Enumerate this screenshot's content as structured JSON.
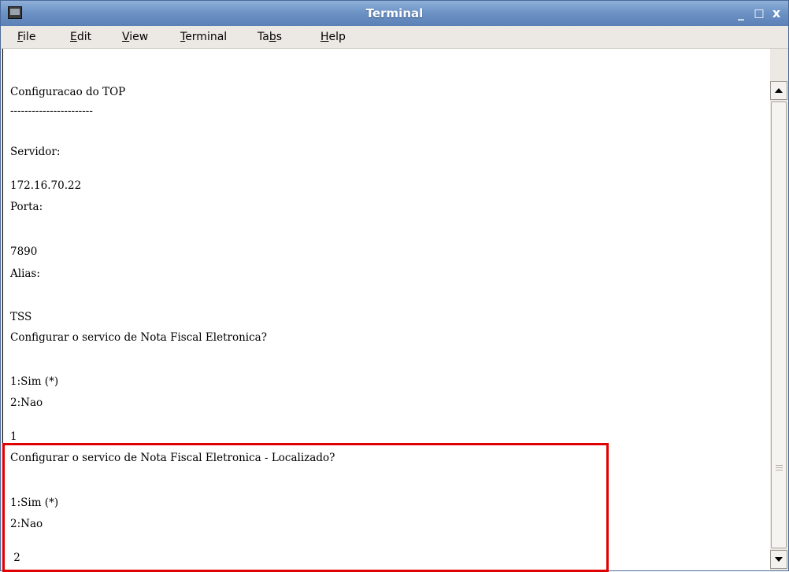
{
  "window": {
    "title": "Terminal"
  },
  "controls": {
    "minimize": "_",
    "maximize": "□",
    "close": "x"
  },
  "menu": {
    "file": {
      "u": "F",
      "rest": "ile"
    },
    "edit": {
      "u": "E",
      "rest": "dit"
    },
    "view": {
      "u": "V",
      "rest": "iew"
    },
    "terminal": {
      "u": "T",
      "rest": "erminal"
    },
    "tabs": {
      "pre": "Ta",
      "u": "b",
      "rest": "s"
    },
    "help": {
      "u": "H",
      "rest": "elp"
    }
  },
  "lines": [
    "Configuracao do TOP",
    "-----------------------",
    "",
    "Servidor:",
    "",
    "172.16.70.22",
    "Porta:",
    "",
    "7890",
    "Alias:",
    "",
    "TSS",
    "Configurar o servico de Nota Fiscal Eletronica?",
    "",
    "1:Sim (*)",
    "2:Nao",
    "",
    "1",
    "Configurar o servico de Nota Fiscal Eletronica - Localizado?",
    "",
    "1:Sim (*)",
    "2:Nao",
    "",
    " 2"
  ]
}
